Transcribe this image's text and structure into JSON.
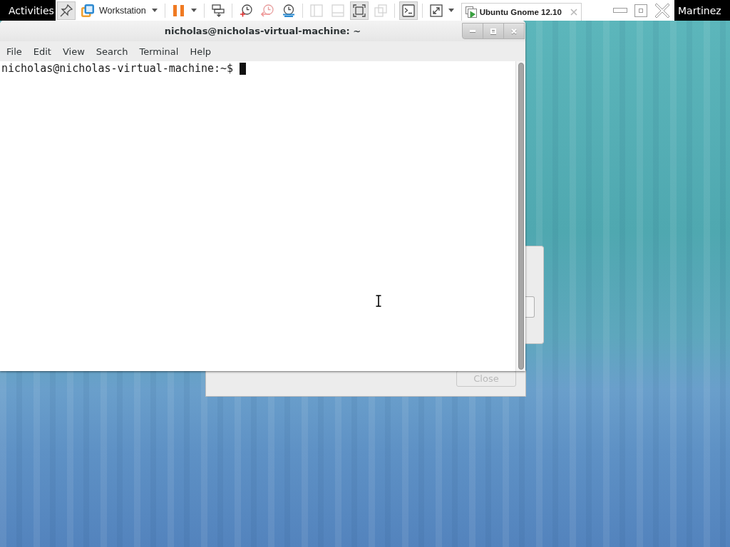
{
  "top_bar": {
    "activities": "Activities",
    "user": "Martinez"
  },
  "vm_toolbar": {
    "groups": [
      {
        "buttons": [
          {
            "kind": "pin",
            "pressed": true,
            "disabled": false
          },
          {
            "kind": "app-menu",
            "label": "Workstation",
            "pressed": false,
            "disabled": false
          }
        ]
      },
      {
        "buttons": [
          {
            "kind": "pause",
            "pressed": false,
            "disabled": false
          }
        ]
      },
      {
        "buttons": [
          {
            "kind": "send-keys",
            "pressed": false,
            "disabled": false
          }
        ]
      },
      {
        "buttons": [
          {
            "kind": "snapshot",
            "pressed": false,
            "disabled": false
          },
          {
            "kind": "revert",
            "pressed": false,
            "disabled": true
          },
          {
            "kind": "snapshot-manager",
            "pressed": false,
            "disabled": false
          }
        ]
      },
      {
        "buttons": [
          {
            "kind": "sidebar",
            "pressed": false,
            "disabled": true
          },
          {
            "kind": "thumbnail-bar",
            "pressed": false,
            "disabled": true
          },
          {
            "kind": "console-view",
            "pressed": true,
            "disabled": false
          },
          {
            "kind": "overlap-view",
            "pressed": false,
            "disabled": true
          }
        ]
      },
      {
        "buttons": [
          {
            "kind": "console",
            "pressed": true,
            "disabled": false
          }
        ]
      },
      {
        "buttons": [
          {
            "kind": "fullscreen",
            "pressed": false,
            "disabled": false
          }
        ]
      }
    ],
    "tabs": [
      {
        "label": "Ubuntu Gnome 12.10",
        "selected": true
      }
    ]
  },
  "terminal_window": {
    "title": "nicholas@nicholas-virtual-machine: ~",
    "menu": [
      "File",
      "Edit",
      "View",
      "Search",
      "Terminal",
      "Help"
    ],
    "lines": [
      "nicholas@nicholas-virtual-machine:~$"
    ]
  },
  "background_dialog": {
    "buttons": [
      {
        "label": "Close",
        "disabled": true
      }
    ]
  }
}
